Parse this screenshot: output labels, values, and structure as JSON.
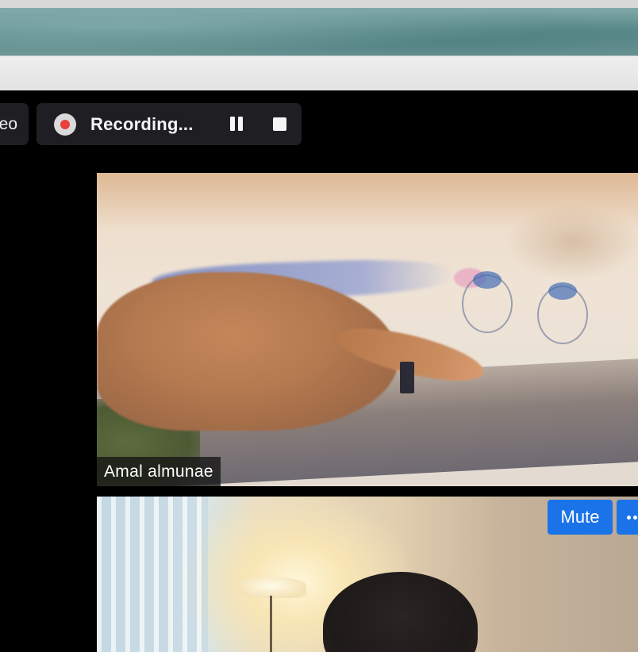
{
  "toolbar": {
    "video_label_partial": "eo",
    "recording_label": "Recording..."
  },
  "participants": [
    {
      "name": "Amal almunae"
    },
    {
      "name": ""
    }
  ],
  "participant_actions": {
    "mute_label": "Mute"
  },
  "colors": {
    "accent_blue": "#1a73e8",
    "recording_red": "#e8403a",
    "pill_bg": "#1f1f23"
  },
  "icons": [
    "record-icon",
    "pause-icon",
    "stop-icon",
    "more-options-icon"
  ]
}
